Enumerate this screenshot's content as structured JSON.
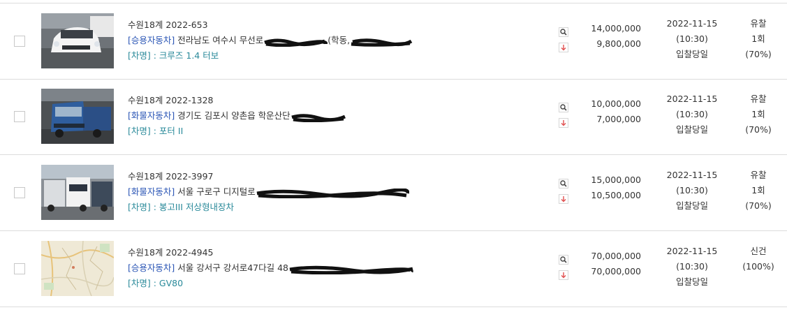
{
  "items": [
    {
      "case_no": "수원18계 2022-653",
      "category": "[승용자동차]",
      "address": "전라남도 여수시 무선로",
      "address_tail": "(학동,",
      "model": "[차명] : 크루즈 1.4 터보",
      "appraisal": "14,000,000",
      "minimum": "9,800,000",
      "date": "2022-11-15",
      "time": "(10:30)",
      "date_note": "입찰당일",
      "status": "유찰",
      "count": "1회",
      "rate": "(70%)",
      "thumb": "white-sedan-photo"
    },
    {
      "case_no": "수원18계 2022-1328",
      "category": "[화물자동차]",
      "address": "경기도 김포시 양촌읍 학운산단",
      "address_tail": "",
      "model": "[차명] : 포터 II",
      "appraisal": "10,000,000",
      "minimum": "7,000,000",
      "date": "2022-11-15",
      "time": "(10:30)",
      "date_note": "입찰당일",
      "status": "유찰",
      "count": "1회",
      "rate": "(70%)",
      "thumb": "blue-truck-photo"
    },
    {
      "case_no": "수원18계 2022-3997",
      "category": "[화물자동차]",
      "address": "서울 구로구 디지털로",
      "address_tail": "",
      "model": "[차명] : 봉고III 저상형내장차",
      "appraisal": "15,000,000",
      "minimum": "10,500,000",
      "date": "2022-11-15",
      "time": "(10:30)",
      "date_note": "입찰당일",
      "status": "유찰",
      "count": "1회",
      "rate": "(70%)",
      "thumb": "parked-trucks-photo"
    },
    {
      "case_no": "수원18계 2022-4945",
      "category": "[승용자동차]",
      "address": "서울 강서구 강서로47다길 48",
      "address_tail": "",
      "model": "[차명] : GV80",
      "appraisal": "70,000,000",
      "minimum": "70,000,000",
      "date": "2022-11-15",
      "time": "(10:30)",
      "date_note": "입찰당일",
      "status": "신건",
      "count": "",
      "rate": "(100%)",
      "thumb": "map-image"
    }
  ],
  "colors": {
    "category": "#2a55b5",
    "model": "#2a8a9a",
    "down_arrow": "#e05050",
    "border": "#dcdcdc"
  }
}
